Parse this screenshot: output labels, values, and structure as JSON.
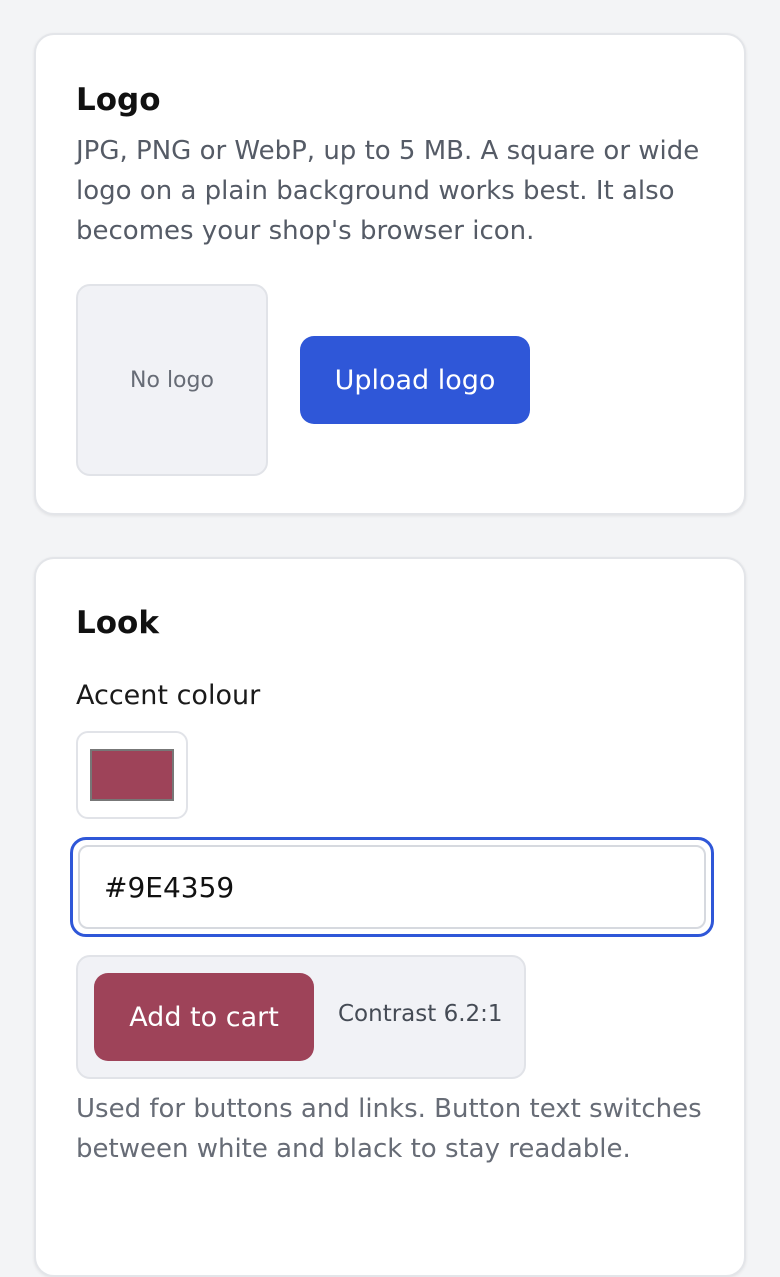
{
  "logo_section": {
    "title": "Logo",
    "description": "JPG, PNG or WebP, up to 5 MB. A square or wide logo on a plain background works best. It also becomes your shop's browser icon.",
    "preview_placeholder": "No logo",
    "upload_label": "Upload logo"
  },
  "look_section": {
    "title": "Look",
    "accent_label": "Accent colour",
    "accent_value": "#9E4359",
    "preview_button_label": "Add to cart",
    "contrast_text": "Contrast 6.2:1",
    "help_text": "Used for buttons and links. Button text switches between white and black to stay readable."
  },
  "colors": {
    "primary": "#2f57d8",
    "accent": "#9E4359"
  }
}
